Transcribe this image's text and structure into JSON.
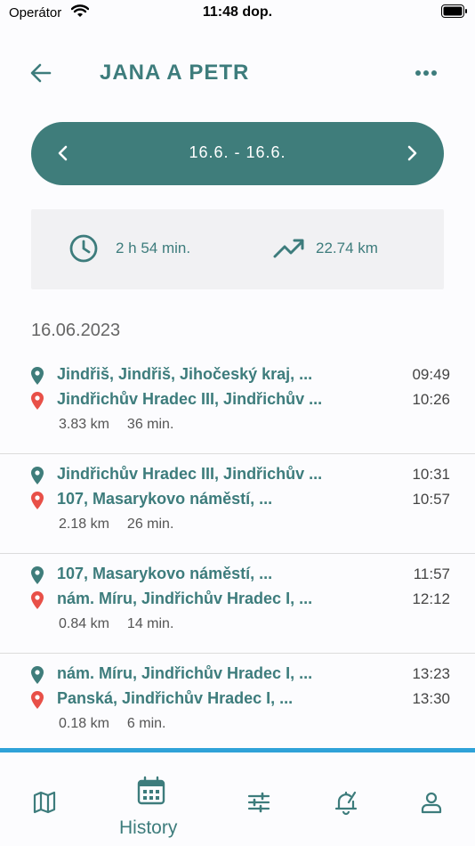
{
  "status_bar": {
    "carrier": "Operátor",
    "time": "11:48 dop."
  },
  "header": {
    "title": "JANA A PETR"
  },
  "date_range": {
    "label": "16.6. - 16.6."
  },
  "summary": {
    "duration": "2 h 54 min.",
    "distance": "22.74 km"
  },
  "date_heading": "16.06.2023",
  "trips": [
    {
      "from": "Jindřiš, Jindřiš, Jihočeský kraj, ...",
      "from_time": "09:49",
      "to": "Jindřichův Hradec III, Jindřichův ...",
      "to_time": "10:26",
      "distance": "3.83 km",
      "duration": "36 min."
    },
    {
      "from": "Jindřichův Hradec III, Jindřichův ...",
      "from_time": "10:31",
      "to": "107, Masarykovo náměstí, ...",
      "to_time": "10:57",
      "distance": "2.18 km",
      "duration": "26 min."
    },
    {
      "from": "107, Masarykovo náměstí, ...",
      "from_time": "11:57",
      "to": "nám. Míru, Jindřichův Hradec I, ...",
      "to_time": "12:12",
      "distance": "0.84 km",
      "duration": "14 min."
    },
    {
      "from": "nám. Míru, Jindřichův Hradec I, ...",
      "from_time": "13:23",
      "to": "Panská, Jindřichův Hradec I, ...",
      "to_time": "13:30",
      "distance": "0.18 km",
      "duration": "6 min."
    }
  ],
  "bottom_nav": {
    "active_label": "History",
    "items": [
      "map-icon",
      "calendar-icon",
      "sliders-icon",
      "alarm-icon",
      "person-icon"
    ]
  },
  "colors": {
    "accent": "#3f7d7b",
    "pin_start": "#3f7d7b",
    "pin_end": "#e85048",
    "nav_border": "#2fa2d8"
  }
}
